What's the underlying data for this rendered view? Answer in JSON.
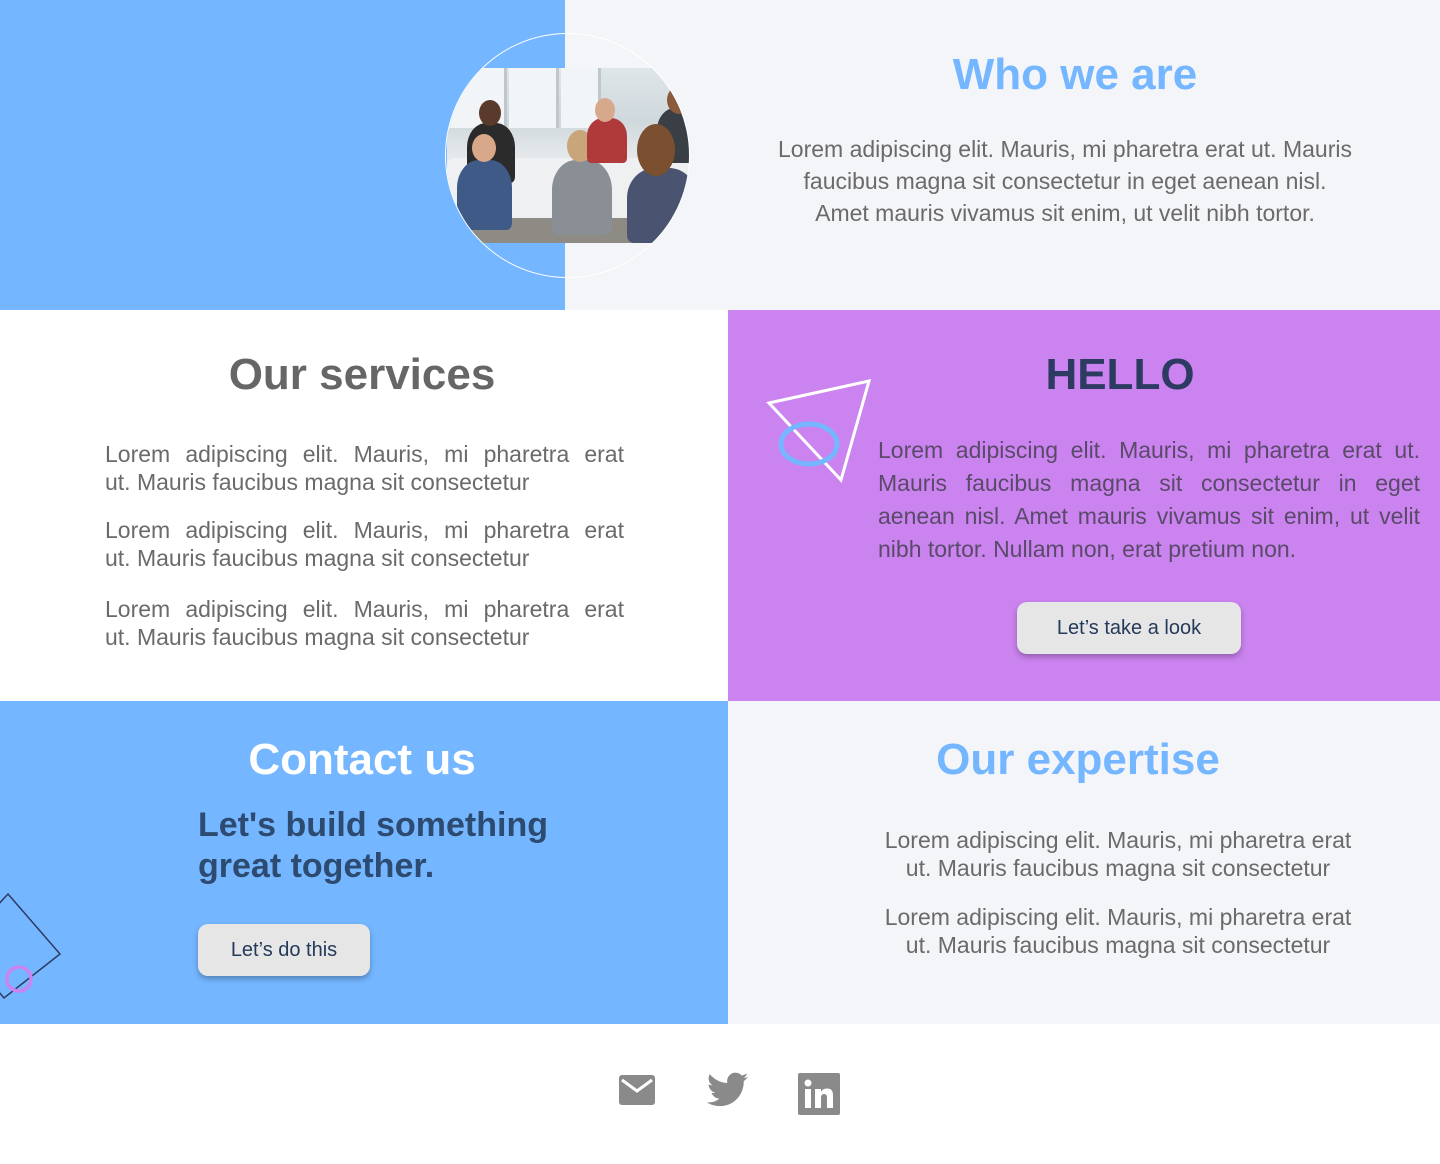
{
  "who_we_are": {
    "title": "Who we are",
    "text_lines": [
      "Lorem adipiscing elit. Mauris, mi pharetra erat ut. Mauris",
      "faucibus magna sit consectetur in eget aenean nisl.",
      "Amet mauris vivamus sit enim, ut velit nibh tortor."
    ]
  },
  "services": {
    "title": "Our services",
    "items": [
      {
        "line1": "Lorem adipiscing elit. Mauris, mi pharetra erat",
        "line2": "ut. Mauris faucibus magna sit consectetur"
      },
      {
        "line1": "Lorem adipiscing elit. Mauris, mi pharetra erat",
        "line2": "ut. Mauris faucibus magna sit consectetur"
      },
      {
        "line1": "Lorem adipiscing elit. Mauris, mi pharetra erat",
        "line2": "ut. Mauris faucibus magna sit consectetur"
      }
    ]
  },
  "hello": {
    "title": "HELLO",
    "text_lines": [
      "Lorem adipiscing elit. Mauris, mi pharetra erat ut.",
      "Mauris faucibus magna sit consectetur in eget",
      "aenean nisl. Amet mauris vivamus sit enim, ut velit",
      "nibh tortor. Nullam non, erat pretium non."
    ],
    "button_label": "Let’s take a look"
  },
  "contact": {
    "title": "Contact us",
    "tagline_line1": "Let's build something",
    "tagline_line2": "great together.",
    "button_label": "Let’s do this"
  },
  "expertise": {
    "title": "Our expertise",
    "items": [
      {
        "line1": "Lorem adipiscing elit. Mauris, mi pharetra erat",
        "line2": "ut. Mauris faucibus magna sit consectetur"
      },
      {
        "line1": "Lorem adipiscing elit. Mauris, mi pharetra erat",
        "line2": "ut. Mauris faucibus magna sit consectetur"
      }
    ]
  },
  "footer": {
    "icons": [
      "mail-icon",
      "twitter-icon",
      "linkedin-icon"
    ]
  },
  "colors": {
    "blue": "#74b6ff",
    "purple": "#cb83ef",
    "light_gray_bg": "#f4f5f9",
    "dark_navy": "#2d3b63",
    "body_text": "#6a6a6a",
    "button_bg": "#e6e6e6"
  }
}
